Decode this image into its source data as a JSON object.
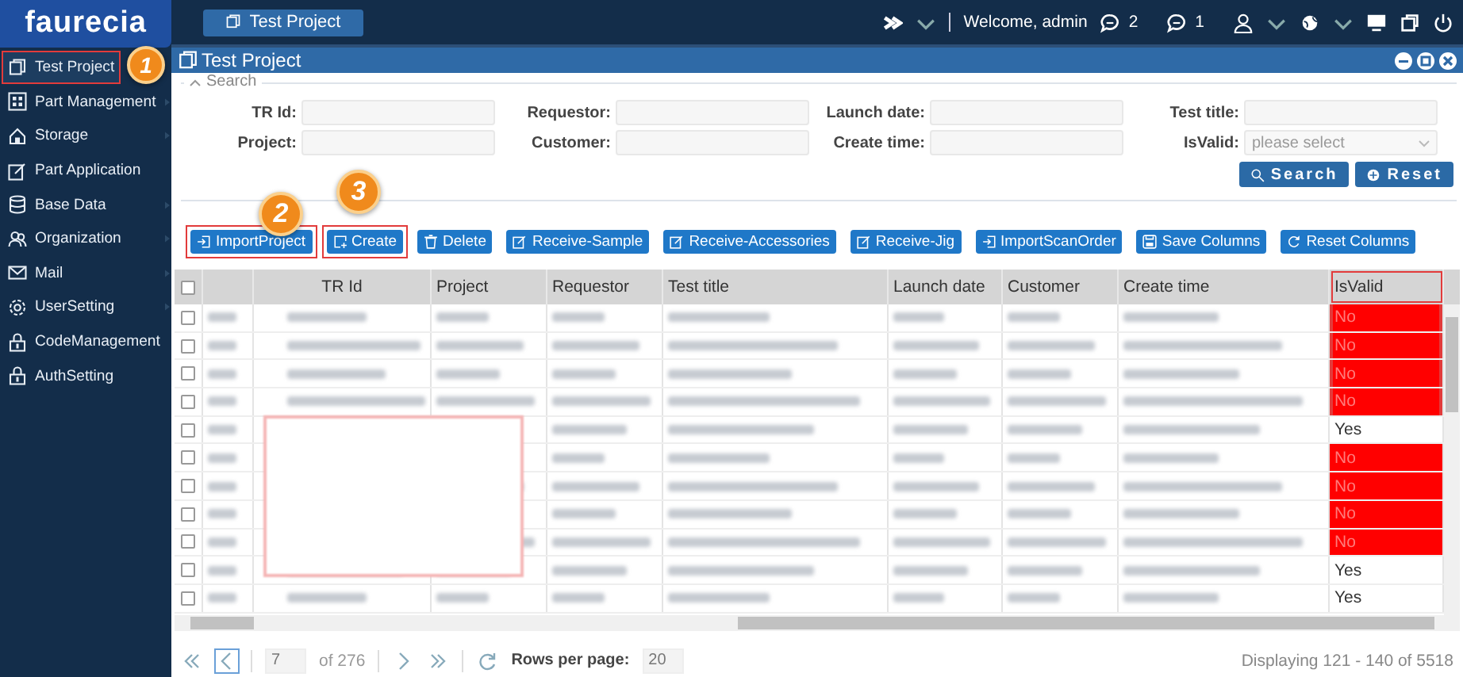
{
  "logo": {
    "text": "faurecia"
  },
  "top_bar": {
    "tabs": [
      {
        "label": "Test Project",
        "selected": true
      }
    ],
    "welcome": "Welcome, admin",
    "messages": "2",
    "notices": "1"
  },
  "sidebar": {
    "items": [
      {
        "label": "Test Project",
        "selected": true,
        "submenu": false,
        "highlighted": true
      },
      {
        "label": "Part Management",
        "selected": false,
        "submenu": true,
        "highlighted": false
      },
      {
        "label": "Storage",
        "selected": false,
        "submenu": true,
        "highlighted": false
      },
      {
        "label": "Part Application",
        "selected": false,
        "submenu": false,
        "highlighted": false
      },
      {
        "label": "Base Data",
        "selected": false,
        "submenu": true,
        "highlighted": false
      },
      {
        "label": "Organization",
        "selected": false,
        "submenu": true,
        "highlighted": false
      },
      {
        "label": "Mail",
        "selected": false,
        "submenu": true,
        "highlighted": false
      },
      {
        "label": "UserSetting",
        "selected": false,
        "submenu": true,
        "highlighted": false
      },
      {
        "label": "CodeManagement",
        "selected": false,
        "submenu": false,
        "highlighted": false
      },
      {
        "label": "AuthSetting",
        "selected": false,
        "submenu": false,
        "highlighted": false
      }
    ]
  },
  "panel": {
    "title": "Test Project"
  },
  "search": {
    "legend": "Search",
    "expanded": true,
    "fields": [
      {
        "label": "TR Id:",
        "kind": "text"
      },
      {
        "label": "Requestor:",
        "kind": "text"
      },
      {
        "label": "Launch date:",
        "kind": "text"
      },
      {
        "label": "Test title:",
        "kind": "text"
      },
      {
        "label": "Project:",
        "kind": "text"
      },
      {
        "label": "Customer:",
        "kind": "text"
      },
      {
        "label": "Create time:",
        "kind": "text"
      },
      {
        "label": "IsValid:",
        "kind": "select",
        "placeholder": "please select"
      }
    ],
    "buttons": [
      "Search",
      "Reset"
    ]
  },
  "toolbar": {
    "buttons": [
      {
        "label": "ImportProject",
        "highlighted": true
      },
      {
        "label": "Create",
        "highlighted": true
      },
      {
        "label": "Delete",
        "highlighted": false
      },
      {
        "label": "Receive-Sample",
        "highlighted": false
      },
      {
        "label": "Receive-Accessories",
        "highlighted": false
      },
      {
        "label": "Receive-Jig",
        "highlighted": false
      },
      {
        "label": "ImportScanOrder",
        "highlighted": false
      },
      {
        "label": "Save Columns",
        "highlighted": false
      },
      {
        "label": "Reset Columns",
        "highlighted": false
      }
    ]
  },
  "table": {
    "select_all_checked": false,
    "columns": [
      {
        "label": "TR Id",
        "highlighted": false
      },
      {
        "label": "Project",
        "highlighted": false
      },
      {
        "label": "Requestor",
        "highlighted": false
      },
      {
        "label": "Test title",
        "highlighted": false
      },
      {
        "label": "Launch date",
        "highlighted": false
      },
      {
        "label": "Customer",
        "highlighted": false
      },
      {
        "label": "Create time",
        "highlighted": false
      },
      {
        "label": "IsValid",
        "highlighted": true
      }
    ],
    "rows": [
      {
        "checked": false,
        "is_valid": "No",
        "highlighted": true
      },
      {
        "checked": false,
        "is_valid": "No",
        "highlighted": true
      },
      {
        "checked": false,
        "is_valid": "No",
        "highlighted": true
      },
      {
        "checked": false,
        "is_valid": "No",
        "highlighted": true
      },
      {
        "checked": false,
        "is_valid": "Yes",
        "highlighted": false
      },
      {
        "checked": false,
        "is_valid": "No",
        "highlighted": false
      },
      {
        "checked": false,
        "is_valid": "No",
        "highlighted": false
      },
      {
        "checked": false,
        "is_valid": "No",
        "highlighted": false
      },
      {
        "checked": false,
        "is_valid": "No",
        "highlighted": false
      },
      {
        "checked": false,
        "is_valid": "Yes",
        "highlighted": false
      },
      {
        "checked": false,
        "is_valid": "Yes",
        "highlighted": false
      }
    ]
  },
  "pager": {
    "page": "7",
    "of": "of 276",
    "rows_label": "Rows per page:",
    "rows_per_page": "20",
    "display": "Displaying 121 - 140 of 5518"
  },
  "annotations": [
    {
      "number": "1"
    },
    {
      "number": "2"
    },
    {
      "number": "3"
    }
  ]
}
